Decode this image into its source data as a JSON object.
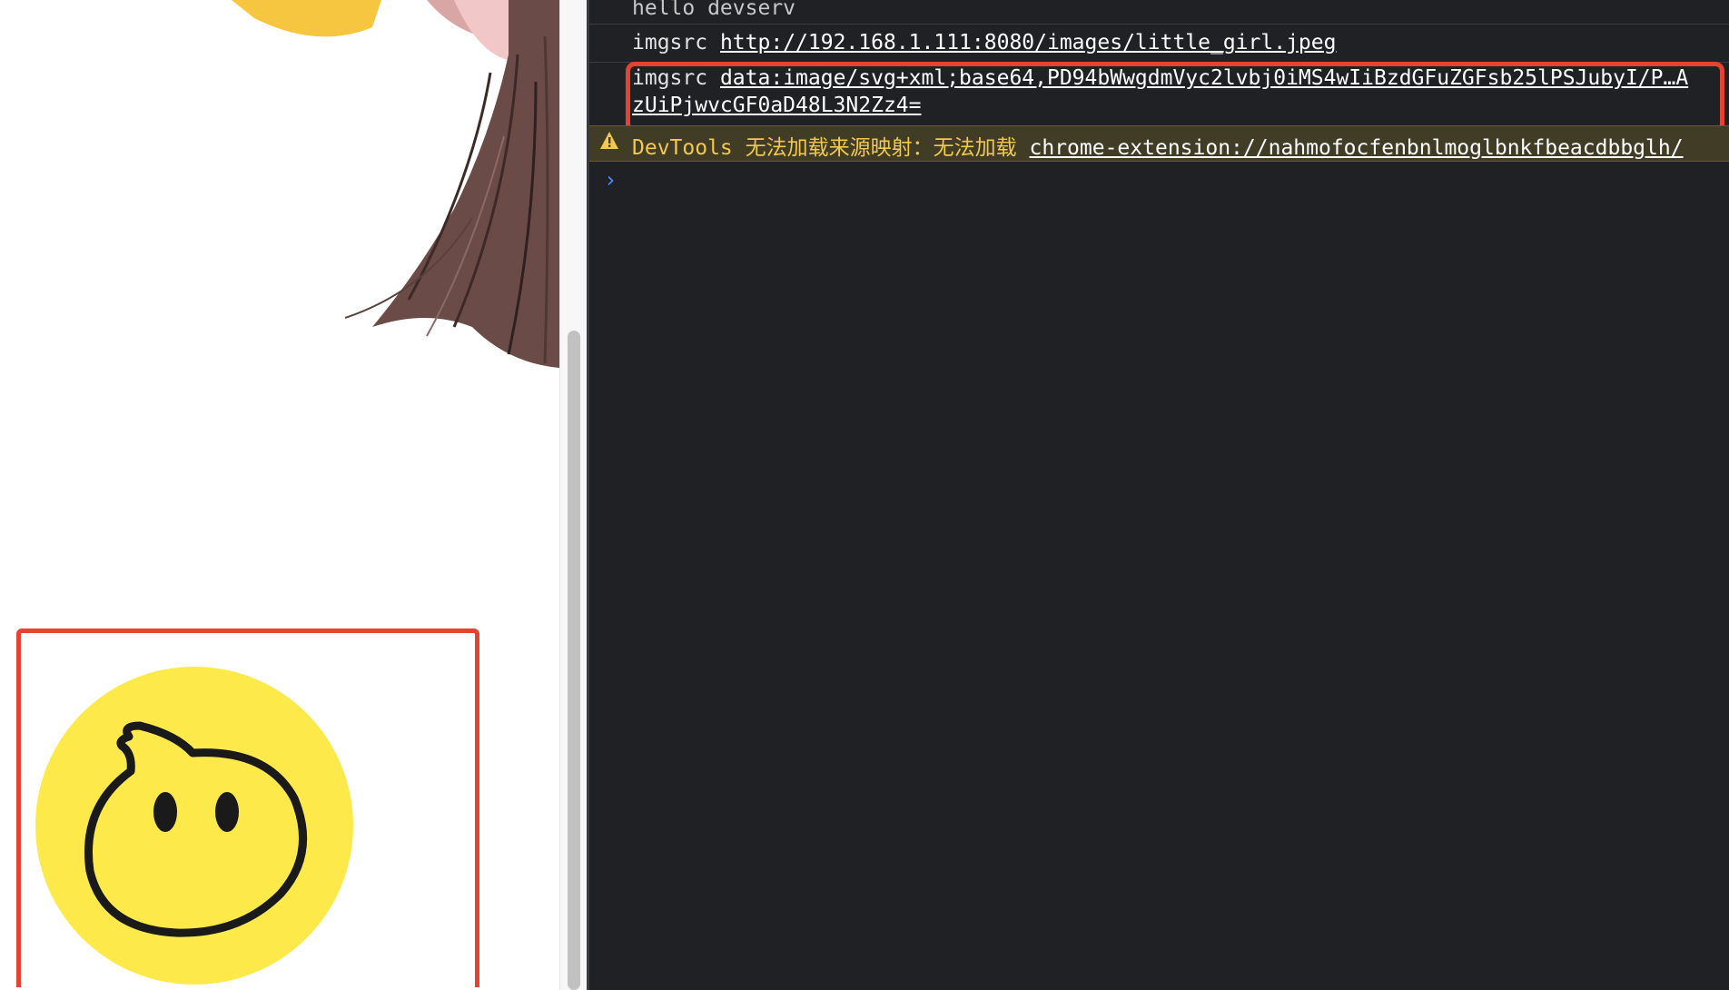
{
  "console": {
    "messages": [
      {
        "text": "hello devserv"
      },
      {
        "label": "imgsrc",
        "link": "http://192.168.1.111:8080/images/little_girl.jpeg"
      },
      {
        "label": "imgsrc",
        "link_line1": "data:image/svg+xml;base64,PD94bWwgdmVyc2lvbj0iMS4wIiBzdGFuZGFsb25lPSJubyI/P…A",
        "link_line2": "zUiPjwvcGF0aD48L3N2Zz4="
      }
    ],
    "warning": {
      "source": "DevTools",
      "text": "无法加载来源映射：无法加载",
      "link": "chrome-extension://nahmofocfenbnlmoglbnkfbeacdbbglh/"
    },
    "prompt": "›"
  },
  "colors": {
    "highlight": "#e3432f",
    "console_bg": "#202124",
    "warning_bg": "#413c26",
    "warning_text": "#f2c94c",
    "emoji_yellow": "#fdea4a",
    "prompt_blue": "#4c8df6"
  },
  "icons": [
    "warning-icon",
    "prompt-chevron-icon",
    "speech-bubble-face-icon"
  ]
}
